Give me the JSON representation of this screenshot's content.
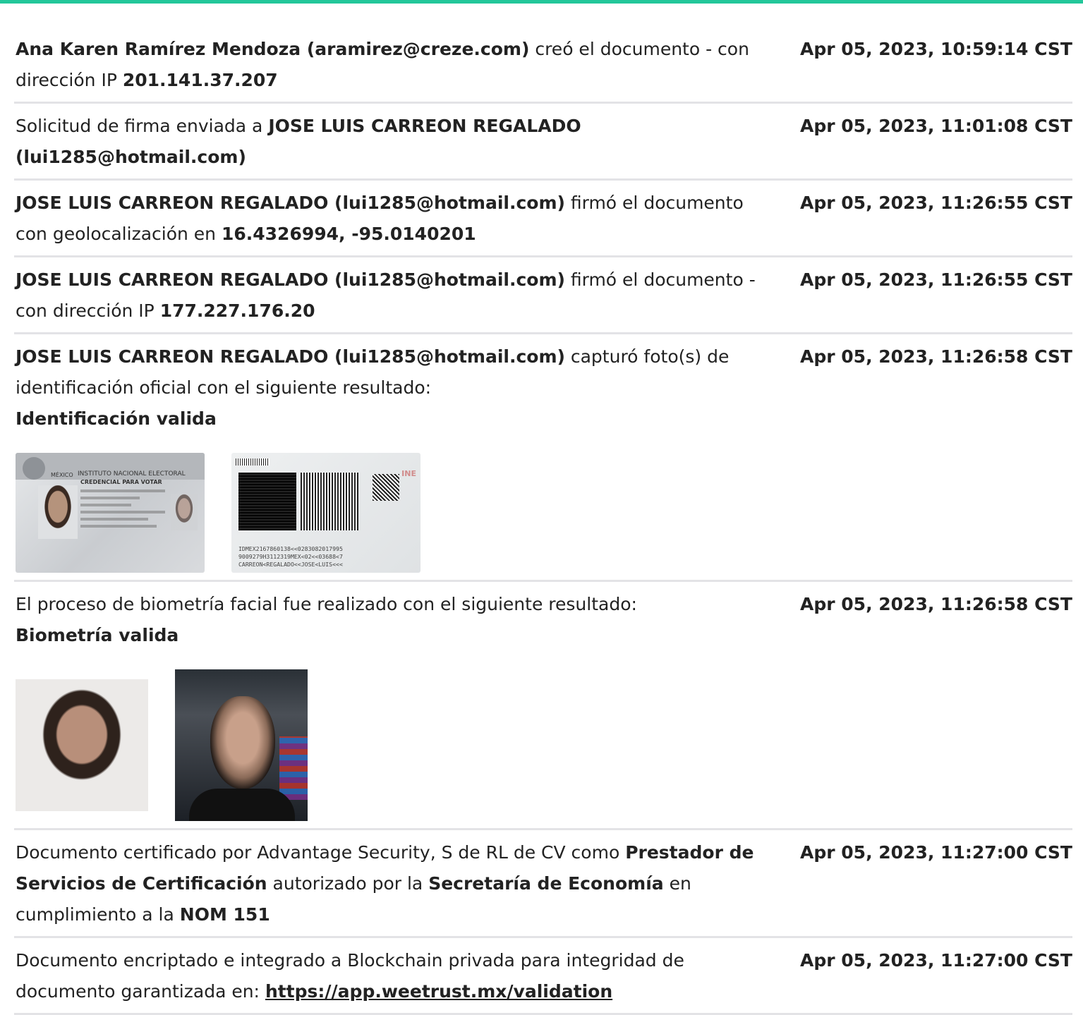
{
  "events": [
    {
      "parts": [
        {
          "t": "Ana Karen Ramírez Mendoza (aramirez@creze.com)",
          "b": true
        },
        {
          "t": " creó el documento - con dirección IP ",
          "b": false
        },
        {
          "t": "201.141.37.207",
          "b": true
        }
      ],
      "time": "Apr 05, 2023, 10:59:14 CST"
    },
    {
      "parts": [
        {
          "t": "Solicitud de firma enviada a ",
          "b": false
        },
        {
          "t": "JOSE LUIS CARREON REGALADO (lui1285@hotmail.com)",
          "b": true
        }
      ],
      "time": "Apr 05, 2023, 11:01:08 CST"
    },
    {
      "parts": [
        {
          "t": "JOSE LUIS CARREON REGALADO (lui1285@hotmail.com)",
          "b": true
        },
        {
          "t": " firmó el documento con geolocalización en ",
          "b": false
        },
        {
          "t": "16.4326994, -95.0140201",
          "b": true
        }
      ],
      "time": "Apr 05, 2023, 11:26:55 CST"
    },
    {
      "parts": [
        {
          "t": "JOSE LUIS CARREON REGALADO (lui1285@hotmail.com)",
          "b": true
        },
        {
          "t": " firmó el documento - con dirección IP ",
          "b": false
        },
        {
          "t": "177.227.176.20",
          "b": true
        }
      ],
      "time": "Apr 05, 2023, 11:26:55 CST"
    },
    {
      "parts": [
        {
          "t": "JOSE LUIS CARREON REGALADO (lui1285@hotmail.com)",
          "b": true
        },
        {
          "t": " capturó foto(s) de identificación oficial con el siguiente resultado:",
          "b": false
        },
        {
          "t": "Identificación valida",
          "b": true,
          "br": true
        }
      ],
      "time": "Apr 05, 2023, 11:26:58 CST",
      "images": "id"
    },
    {
      "parts": [
        {
          "t": "El proceso de biometría facial fue realizado con el siguiente resultado:",
          "b": false
        },
        {
          "t": "Biometría valida",
          "b": true,
          "br": true
        }
      ],
      "time": "Apr 05, 2023, 11:26:58 CST",
      "images": "bio"
    },
    {
      "parts": [
        {
          "t": "Documento certificado por Advantage Security, S de RL de CV como ",
          "b": false
        },
        {
          "t": "Prestador de Servicios de Certificación",
          "b": true
        },
        {
          "t": " autorizado por la ",
          "b": false
        },
        {
          "t": "Secretaría de Economía",
          "b": true
        },
        {
          "t": " en cumplimiento a la ",
          "b": false
        },
        {
          "t": "NOM 151",
          "b": true
        }
      ],
      "time": "Apr 05, 2023, 11:27:00 CST"
    },
    {
      "parts": [
        {
          "t": "Documento encriptado e integrado a Blockchain privada para integridad de documento garantizada en: ",
          "b": false
        },
        {
          "t": "https://app.weetrust.mx/validation",
          "b": true,
          "link": true
        }
      ],
      "time": "Apr 05, 2023, 11:27:00 CST"
    }
  ],
  "id_card": {
    "front_country": "MÉXICO",
    "front_institute": "INSTITUTO NACIONAL ELECTORAL",
    "front_credential": "CREDENCIAL PARA VOTAR",
    "back_logo": "INE",
    "back_mrz": [
      "IDMEX2167860138<<0283082017995",
      "9009279H3112319MEX<02<<03688<7",
      "CARREON<REGALADO<<JOSE<LUIS<<<"
    ]
  },
  "icons": {
    "id_front": "id-card-front-image",
    "id_back": "id-card-back-image",
    "face_id": "id-face-photo",
    "face_selfie": "selfie-photo"
  },
  "colors": {
    "accent": "#23c79a",
    "divider": "#e3e3e6",
    "text": "#222222"
  }
}
